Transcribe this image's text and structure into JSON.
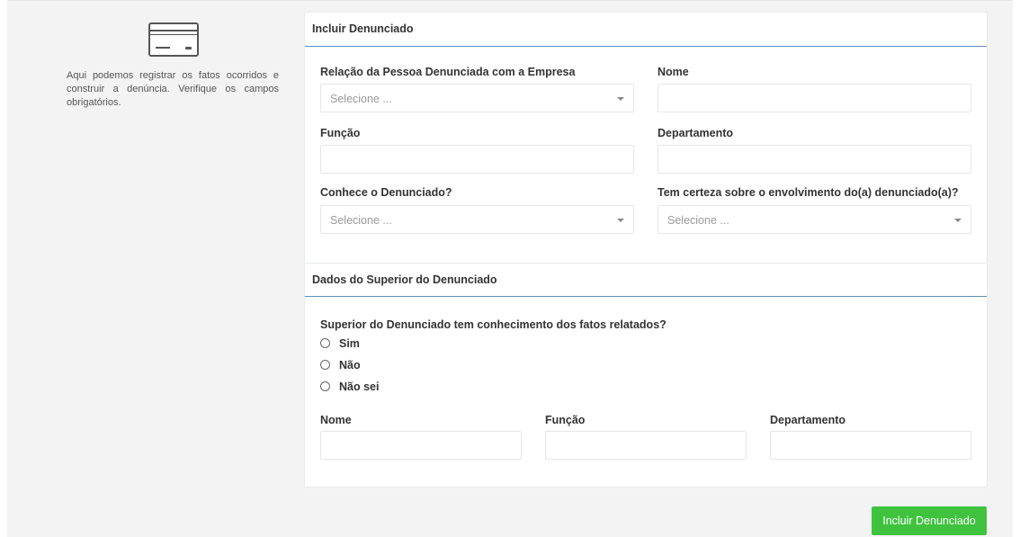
{
  "left": {
    "icon": "credit-card-icon",
    "description": "Aqui podemos registrar os fatos ocorridos e construir a denúncia. Verifique os campos obrigatórios."
  },
  "section1": {
    "title": "Incluir Denunciado",
    "relacao_label": "Relação da Pessoa Denunciada com a Empresa",
    "relacao_value": "Selecione ...",
    "nome_label": "Nome",
    "nome_value": "",
    "funcao_label": "Função",
    "funcao_value": "",
    "departamento_label": "Departamento",
    "departamento_value": "",
    "conhece_label": "Conhece o Denunciado?",
    "conhece_value": "Selecione ...",
    "certeza_label": "Tem certeza sobre o envolvimento do(a) denunciado(a)?",
    "certeza_value": "Selecione ..."
  },
  "section2": {
    "title": "Dados do Superior do Denunciado",
    "question": "Superior do Denunciado tem conhecimento dos fatos relatados?",
    "options": [
      "Sim",
      "Não",
      "Não sei"
    ],
    "nome_label": "Nome",
    "funcao_label": "Função",
    "departamento_label": "Departamento"
  },
  "submit_label": "Incluir Denunciado",
  "colors": {
    "accent_line": "#5b8fb9",
    "submit_button": "#3fc33f",
    "page_background": "#f3f3f4"
  }
}
